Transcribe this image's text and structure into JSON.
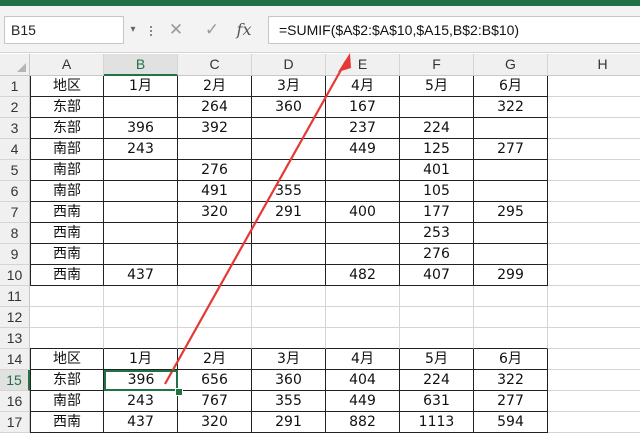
{
  "name_box": {
    "value": "B15",
    "dropdown_icon": "chevron-down-icon"
  },
  "formula_bar": {
    "cancel_icon": "✕",
    "enter_icon": "✓",
    "function_icon": "fx",
    "formula": "=SUMIF($A$2:$A$10,$A15,B$2:B$10)"
  },
  "columns": [
    "A",
    "B",
    "C",
    "D",
    "E",
    "F",
    "G",
    "H"
  ],
  "rows": [
    "1",
    "2",
    "3",
    "4",
    "5",
    "6",
    "7",
    "8",
    "9",
    "10",
    "11",
    "12",
    "13",
    "14",
    "15",
    "16",
    "17"
  ],
  "selected_cell": {
    "column": "B",
    "row": "15"
  },
  "sheet": [
    [
      "地区",
      "1月",
      "2月",
      "3月",
      "4月",
      "5月",
      "6月",
      ""
    ],
    [
      "东部",
      "",
      "264",
      "360",
      "167",
      "",
      "322",
      ""
    ],
    [
      "东部",
      "396",
      "392",
      "",
      "237",
      "224",
      "",
      ""
    ],
    [
      "南部",
      "243",
      "",
      "",
      "449",
      "125",
      "277",
      ""
    ],
    [
      "南部",
      "",
      "276",
      "",
      "",
      "401",
      "",
      ""
    ],
    [
      "南部",
      "",
      "491",
      "355",
      "",
      "105",
      "",
      ""
    ],
    [
      "西南",
      "",
      "320",
      "291",
      "400",
      "177",
      "295",
      ""
    ],
    [
      "西南",
      "",
      "",
      "",
      "",
      "253",
      "",
      ""
    ],
    [
      "西南",
      "",
      "",
      "",
      "",
      "276",
      "",
      ""
    ],
    [
      "西南",
      "437",
      "",
      "",
      "482",
      "407",
      "299",
      ""
    ],
    [
      "",
      "",
      "",
      "",
      "",
      "",
      "",
      ""
    ],
    [
      "",
      "",
      "",
      "",
      "",
      "",
      "",
      ""
    ],
    [
      "",
      "",
      "",
      "",
      "",
      "",
      "",
      ""
    ],
    [
      "地区",
      "1月",
      "2月",
      "3月",
      "4月",
      "5月",
      "6月",
      ""
    ],
    [
      "东部",
      "396",
      "656",
      "360",
      "404",
      "224",
      "322",
      ""
    ],
    [
      "南部",
      "243",
      "767",
      "355",
      "449",
      "631",
      "277",
      ""
    ],
    [
      "西南",
      "437",
      "320",
      "291",
      "882",
      "1113",
      "594",
      ""
    ]
  ],
  "annotation": {
    "type": "red-arrow",
    "color": "#e53935"
  },
  "colors": {
    "accent": "#217346",
    "gridline": "#d4d4d4",
    "table_border": "#222222"
  }
}
